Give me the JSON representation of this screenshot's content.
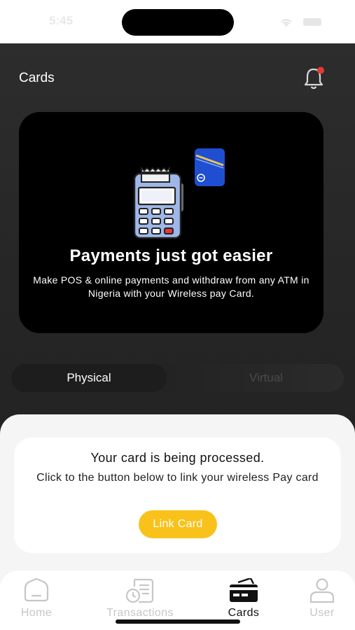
{
  "status_bar": {
    "time": "5:45"
  },
  "header": {
    "title": "Cards"
  },
  "banner": {
    "title": "Payments just got easier",
    "description": "Make POS & online payments and withdraw from any ATM in Nigeria with your Wireless pay Card."
  },
  "card_type_toggle": {
    "options": [
      "Physical",
      "Virtual"
    ],
    "selected": "Physical"
  },
  "card_status": {
    "title": "Your card is being processed.",
    "description": "Click to the button below to link your wireless Pay card",
    "button_label": "Link Card"
  },
  "tab_bar": {
    "tabs": [
      {
        "label": "Home",
        "icon": "home-icon"
      },
      {
        "label": "Transactions",
        "icon": "transactions-icon"
      },
      {
        "label": "Cards",
        "icon": "cards-icon"
      },
      {
        "label": "User",
        "icon": "user-icon"
      }
    ],
    "active": "Cards"
  },
  "colors": {
    "accent": "#f9c21b",
    "notification_dot": "#e53935",
    "card_blue": "#1f4fd0"
  }
}
